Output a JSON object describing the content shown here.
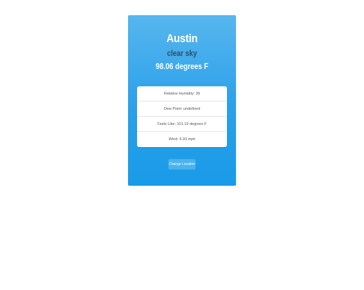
{
  "weather": {
    "city": "Austin",
    "condition": "clear sky",
    "temperature": "98.06 degrees F"
  },
  "details": {
    "humidity": "Relative Humidity: 39",
    "dew_point": "Dew Point: undefined",
    "feels_like": "Feels Like: 101.19 degrees F",
    "wind": "Wind: 6.93 mph"
  },
  "actions": {
    "change_location_label": "Change Location"
  },
  "colors": {
    "card_gradient_top": "#57b6ee",
    "card_gradient_bottom": "#199be8",
    "condition_text": "#2b4e66",
    "button_bg": "#4ab3ee"
  }
}
